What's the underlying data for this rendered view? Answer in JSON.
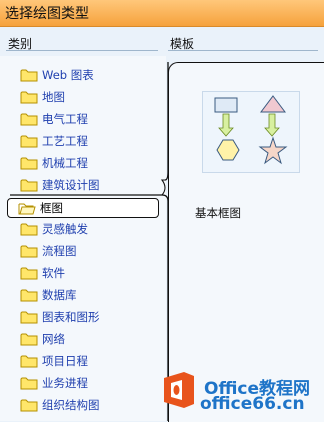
{
  "window": {
    "title": "选择绘图类型"
  },
  "sections": {
    "categories_label": "类别",
    "templates_label": "模板"
  },
  "categories": [
    {
      "label": "Web 图表",
      "selected": false
    },
    {
      "label": "地图",
      "selected": false
    },
    {
      "label": "电气工程",
      "selected": false
    },
    {
      "label": "工艺工程",
      "selected": false
    },
    {
      "label": "机械工程",
      "selected": false
    },
    {
      "label": "建筑设计图",
      "selected": false
    },
    {
      "label": "框图",
      "selected": true
    },
    {
      "label": "灵感触发",
      "selected": false
    },
    {
      "label": "流程图",
      "selected": false
    },
    {
      "label": "软件",
      "selected": false
    },
    {
      "label": "数据库",
      "selected": false
    },
    {
      "label": "图表和图形",
      "selected": false
    },
    {
      "label": "网络",
      "selected": false
    },
    {
      "label": "项目日程",
      "selected": false
    },
    {
      "label": "业务进程",
      "selected": false
    },
    {
      "label": "组织结构图",
      "selected": false
    }
  ],
  "templates": [
    {
      "label": "基本框图"
    }
  ],
  "watermark": {
    "line1": "Office教程网",
    "line2": "office66.cn"
  },
  "colors": {
    "title_bar": "#f6a23c",
    "category_text": "#1f3fae",
    "watermark_blue": "#1e74c8",
    "watermark_orange": "#e8541c"
  },
  "icons": {
    "folder": "folder-icon",
    "logo": "office-logo-icon"
  }
}
